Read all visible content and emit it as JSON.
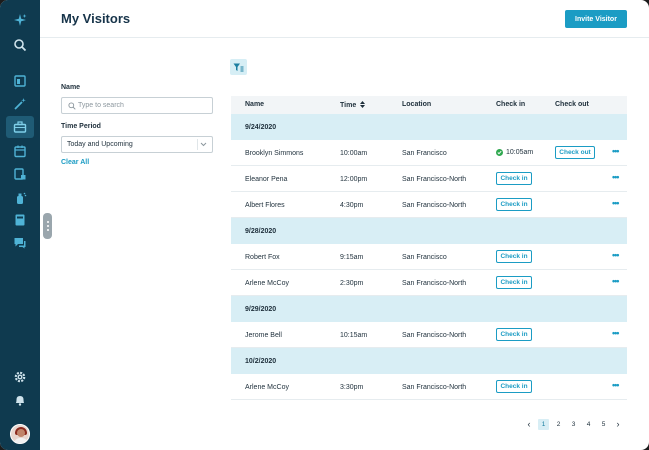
{
  "header": {
    "title": "My Visitors",
    "invite_label": "Invite Visitor"
  },
  "sidebar": {
    "icons": [
      "sparkle-icon",
      "search-icon",
      "dashboard-icon",
      "magic-wand-icon",
      "briefcase-icon",
      "calendar-icon",
      "deliveries-icon",
      "spray-icon",
      "book-icon",
      "chat-icon",
      "gear-icon",
      "bell-icon"
    ],
    "active": "briefcase-icon"
  },
  "filters": {
    "name_label": "Name",
    "search_placeholder": "Type to search",
    "time_period_label": "Time Period",
    "time_period_value": "Today and Upcoming",
    "clear_all": "Clear All"
  },
  "table": {
    "columns": {
      "name": "Name",
      "time": "Time",
      "location": "Location",
      "checkin": "Check in",
      "checkout": "Check out"
    },
    "groups": [
      {
        "date": "9/24/2020",
        "rows": [
          {
            "name": "Brooklyn Simmons",
            "time": "10:00am",
            "location": "San Francisco",
            "checked_in": "10:05am",
            "checkout_label": "Check out"
          },
          {
            "name": "Eleanor Pena",
            "time": "12:00pm",
            "location": "San Francisco-North",
            "checkin_label": "Check in"
          },
          {
            "name": "Albert Flores",
            "time": "4:30pm",
            "location": "San Francisco-North",
            "checkin_label": "Check in"
          }
        ]
      },
      {
        "date": "9/28/2020",
        "rows": [
          {
            "name": "Robert Fox",
            "time": "9:15am",
            "location": "San Francisco",
            "checkin_label": "Check in"
          },
          {
            "name": "Arlene McCoy",
            "time": "2:30pm",
            "location": "San Francisco-North",
            "checkin_label": "Check in"
          }
        ]
      },
      {
        "date": "9/29/2020",
        "rows": [
          {
            "name": "Jerome Bell",
            "time": "10:15am",
            "location": "San Francisco-North",
            "checkin_label": "Check in"
          }
        ]
      },
      {
        "date": "10/2/2020",
        "rows": [
          {
            "name": "Arlene McCoy",
            "time": "3:30pm",
            "location": "San Francisco-North",
            "checkin_label": "Check in"
          }
        ]
      }
    ],
    "more_label": "•••"
  },
  "pagination": {
    "prev": "‹",
    "pages": [
      "1",
      "2",
      "3",
      "4",
      "5"
    ],
    "current": "1",
    "next": "›"
  },
  "colors": {
    "sidebar": "#0f3a4f",
    "accent": "#1b9cc4",
    "date_band": "#d8eef5",
    "success": "#2fa84f"
  }
}
